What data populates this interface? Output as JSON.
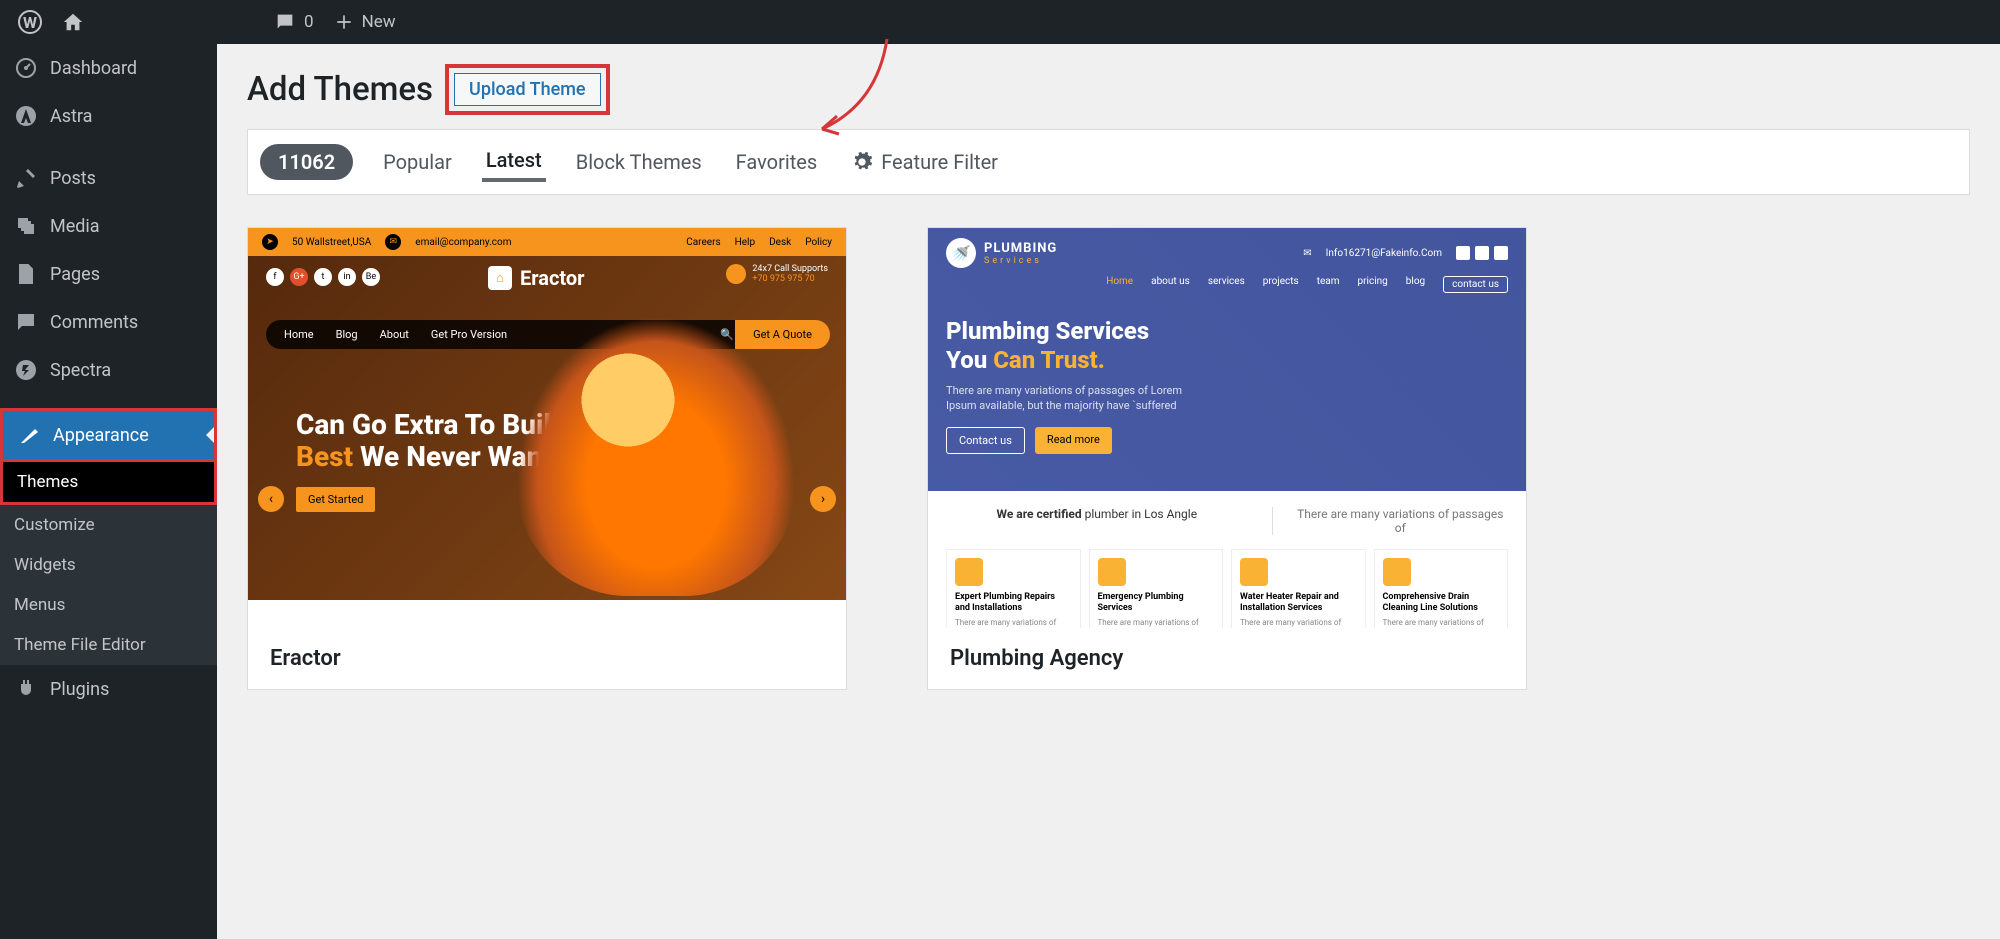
{
  "adminbar": {
    "comments": "0",
    "new": "New"
  },
  "sidebar": {
    "dashboard": "Dashboard",
    "astra": "Astra",
    "posts": "Posts",
    "media": "Media",
    "pages": "Pages",
    "comments": "Comments",
    "spectra": "Spectra",
    "appearance": "Appearance",
    "themes": "Themes",
    "customize": "Customize",
    "widgets": "Widgets",
    "menus": "Menus",
    "theme_file_editor": "Theme File Editor",
    "plugins": "Plugins"
  },
  "header": {
    "title": "Add Themes",
    "upload_button": "Upload Theme"
  },
  "filter": {
    "count": "11062",
    "popular": "Popular",
    "latest": "Latest",
    "block_themes": "Block Themes",
    "favorites": "Favorites",
    "feature_filter": "Feature Filter"
  },
  "themes": [
    {
      "name": "Eractor",
      "preview": {
        "address": "50 Wallstreet,USA",
        "email": "email@company.com",
        "links": [
          "Careers",
          "Help",
          "Desk",
          "Policy"
        ],
        "brand": "Eractor",
        "call_label": "24x7 Call Supports",
        "call_number": "+70 975 975 70",
        "nav": [
          "Home",
          "Blog",
          "About",
          "Get Pro Version"
        ],
        "quote": "Get A Quote",
        "headline_line1": "Can Go Extra To Build The",
        "headline_best": "Best",
        "headline_line2": " We Never Want Fear",
        "cta": "Get Started"
      }
    },
    {
      "name": "Plumbing Agency",
      "preview": {
        "brand_title": "PLUMBING",
        "brand_sub": "Services",
        "email": "Info16271@Fakeinfo.Com",
        "nav": [
          "Home",
          "about us",
          "services",
          "projects",
          "team",
          "pricing",
          "blog",
          "contact us"
        ],
        "headline_l1": "Plumbing Services",
        "headline_l2a": "You ",
        "headline_l2b": "Can Trust.",
        "desc": "There are many variations of passages of Lorem Ipsum available, but the majority have `suffered",
        "btn1": "Contact us",
        "btn2": "Read more",
        "cert_strong": "We are certified",
        "cert_rest": " plumber in Los Angle",
        "cert_right": "There are many variations of passages of",
        "cards": [
          {
            "t": "Expert Plumbing Repairs and Installations",
            "d": "There are many variations of passages of Lorem"
          },
          {
            "t": "Emergency Plumbing Services",
            "d": "There are many variations of passages of Lorem"
          },
          {
            "t": "Water Heater Repair and Installation Services",
            "d": "There are many variations of passages of Lorem"
          },
          {
            "t": "Comprehensive Drain Cleaning Line Solutions",
            "d": "There are many variations of passages of Lorem"
          }
        ]
      }
    }
  ]
}
